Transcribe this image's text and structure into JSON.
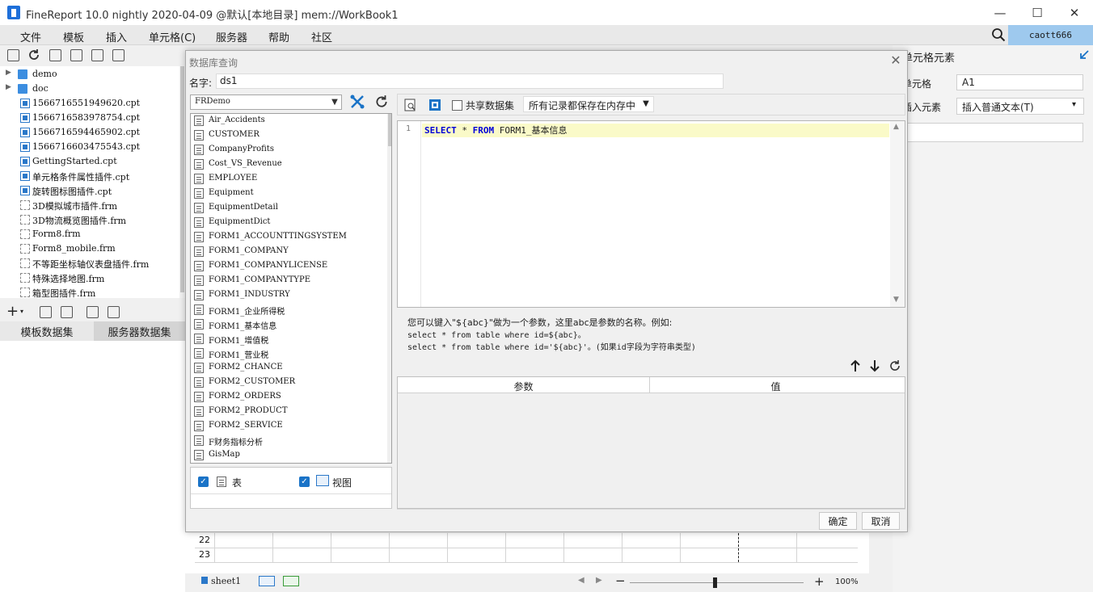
{
  "window": {
    "title": "FineReport 10.0 nightly 2020-04-09 @默认[本地目录]    mem://WorkBook1",
    "minimize": "—",
    "maximize": "☐",
    "close": "✕"
  },
  "menu": [
    "文件",
    "模板",
    "插入",
    "单元格(C)",
    "服务器",
    "帮助",
    "社区"
  ],
  "user": "caott666",
  "file_tree": [
    {
      "name": "demo",
      "type": "folder"
    },
    {
      "name": "doc",
      "type": "folder"
    },
    {
      "name": "1566716551949620.cpt",
      "type": "cpt"
    },
    {
      "name": "1566716583978754.cpt",
      "type": "cpt"
    },
    {
      "name": "1566716594465902.cpt",
      "type": "cpt"
    },
    {
      "name": "1566716603475543.cpt",
      "type": "cpt"
    },
    {
      "name": "GettingStarted.cpt",
      "type": "cpt"
    },
    {
      "name": "单元格条件属性插件.cpt",
      "type": "cpt"
    },
    {
      "name": "旋转图标图插件.cpt",
      "type": "cpt"
    },
    {
      "name": "3D模拟城市插件.frm",
      "type": "frm"
    },
    {
      "name": "3D物流概览图插件.frm",
      "type": "frm"
    },
    {
      "name": "Form8.frm",
      "type": "frm"
    },
    {
      "name": "Form8_mobile.frm",
      "type": "frm"
    },
    {
      "name": "不等距坐标轴仪表盘插件.frm",
      "type": "frm"
    },
    {
      "name": "特殊选择地图.frm",
      "type": "frm"
    },
    {
      "name": "箱型图插件.frm",
      "type": "frm"
    }
  ],
  "dataset_tabs": {
    "template": "模板数据集",
    "server": "服务器数据集"
  },
  "right_panel": {
    "title": "单元格元素",
    "cell_label": "单元格",
    "cell_value": "A1",
    "insert_label": "插入元素",
    "insert_value": "插入普通文本(T)"
  },
  "sheet": {
    "rows": [
      "22",
      "23"
    ],
    "tab": "sheet1",
    "zoom": "100%"
  },
  "dialog": {
    "title": "数据库查询",
    "name_label": "名字:",
    "name_value": "ds1",
    "connection": "FRDemo",
    "tables": [
      "Air_Accidents",
      "CUSTOMER",
      "CompanyProfits",
      "Cost_VS_Revenue",
      "EMPLOYEE",
      "Equipment",
      "EquipmentDetail",
      "EquipmentDict",
      "FORM1_ACCOUNTTINGSYSTEM",
      "FORM1_COMPANY",
      "FORM1_COMPANYLICENSE",
      "FORM1_COMPANYTYPE",
      "FORM1_INDUSTRY",
      "FORM1_企业所得税",
      "FORM1_基本信息",
      "FORM1_增值税",
      "FORM1_营业税",
      "FORM2_CHANCE",
      "FORM2_CUSTOMER",
      "FORM2_ORDERS",
      "FORM2_PRODUCT",
      "FORM2_SERVICE",
      "F财务指标分析",
      "GisMap"
    ],
    "opt_table": "表",
    "opt_view": "视图",
    "share_label": "共享数据集",
    "memory_mode": "所有记录都保存在内存中",
    "sql_line_number": "1",
    "sql": {
      "kw1": "SELECT",
      "star": " * ",
      "kw2": "FROM",
      "rest": " FORM1_基本信息"
    },
    "hint1": "您可以键入\"${abc}\"做为一个参数，这里abc是参数的名称。例如:",
    "hint2": "select * from table where id=${abc}。",
    "hint3": "select * from table where id='${abc}'。(如果id字段为字符串类型)",
    "param_col": "参数",
    "value_col": "值",
    "ok": "确定",
    "cancel": "取消"
  }
}
